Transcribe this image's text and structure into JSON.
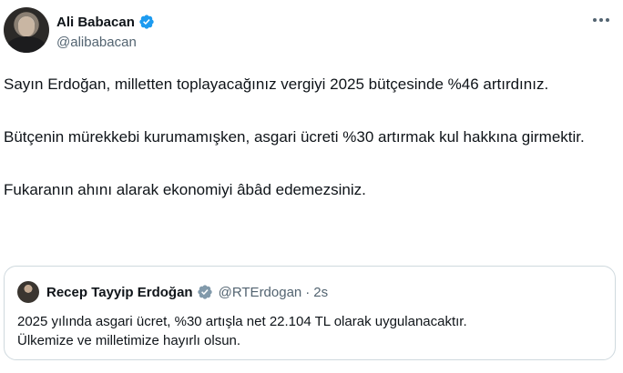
{
  "author": {
    "name": "Ali Babacan",
    "handle": "@alibabacan"
  },
  "tweet": {
    "paragraphs": [
      "Sayın Erdoğan, milletten toplayacağınız vergiyi 2025 bütçesinde %46 artırdınız.",
      "Bütçenin mürekkebi kurumamışken, asgari ücreti %30 artırmak kul hakkına girmektir.",
      "Fukaranın ahını alarak ekonomiyi âbâd edemezsiniz."
    ]
  },
  "quote": {
    "name": "Recep Tayyip Erdoğan",
    "handle": "@RTErdogan",
    "separator": "·",
    "time": "2s",
    "lines": [
      "2025 yılında asgari ücret, %30 artışla net 22.104 TL olarak uygulanacaktır.",
      "Ülkemize ve milletimize hayırlı olsun."
    ]
  },
  "icons": {
    "verified": "verified-badge-icon",
    "more": "more-options-icon"
  },
  "colors": {
    "verified_blue": "#1d9bf0",
    "verified_gray": "#829aab",
    "text_primary": "#0f1419",
    "text_secondary": "#536471",
    "border": "#cfd9de"
  }
}
